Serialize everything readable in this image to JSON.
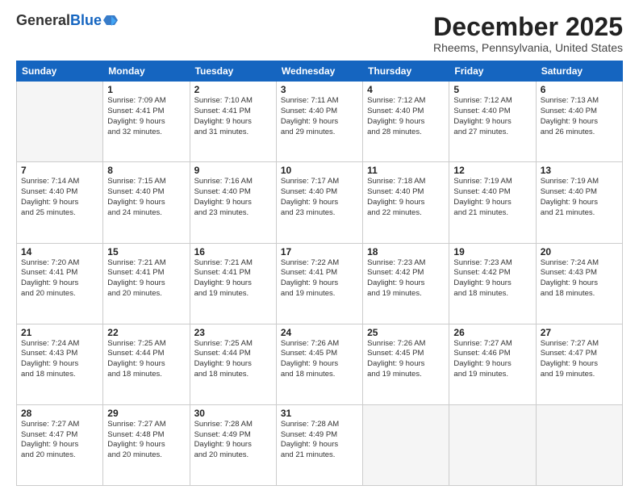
{
  "logo": {
    "general": "General",
    "blue": "Blue"
  },
  "title": "December 2025",
  "subtitle": "Rheems, Pennsylvania, United States",
  "days_of_week": [
    "Sunday",
    "Monday",
    "Tuesday",
    "Wednesday",
    "Thursday",
    "Friday",
    "Saturday"
  ],
  "weeks": [
    [
      {
        "day": "",
        "info": ""
      },
      {
        "day": "1",
        "info": "Sunrise: 7:09 AM\nSunset: 4:41 PM\nDaylight: 9 hours\nand 32 minutes."
      },
      {
        "day": "2",
        "info": "Sunrise: 7:10 AM\nSunset: 4:41 PM\nDaylight: 9 hours\nand 31 minutes."
      },
      {
        "day": "3",
        "info": "Sunrise: 7:11 AM\nSunset: 4:40 PM\nDaylight: 9 hours\nand 29 minutes."
      },
      {
        "day": "4",
        "info": "Sunrise: 7:12 AM\nSunset: 4:40 PM\nDaylight: 9 hours\nand 28 minutes."
      },
      {
        "day": "5",
        "info": "Sunrise: 7:12 AM\nSunset: 4:40 PM\nDaylight: 9 hours\nand 27 minutes."
      },
      {
        "day": "6",
        "info": "Sunrise: 7:13 AM\nSunset: 4:40 PM\nDaylight: 9 hours\nand 26 minutes."
      }
    ],
    [
      {
        "day": "7",
        "info": "Sunrise: 7:14 AM\nSunset: 4:40 PM\nDaylight: 9 hours\nand 25 minutes."
      },
      {
        "day": "8",
        "info": "Sunrise: 7:15 AM\nSunset: 4:40 PM\nDaylight: 9 hours\nand 24 minutes."
      },
      {
        "day": "9",
        "info": "Sunrise: 7:16 AM\nSunset: 4:40 PM\nDaylight: 9 hours\nand 23 minutes."
      },
      {
        "day": "10",
        "info": "Sunrise: 7:17 AM\nSunset: 4:40 PM\nDaylight: 9 hours\nand 23 minutes."
      },
      {
        "day": "11",
        "info": "Sunrise: 7:18 AM\nSunset: 4:40 PM\nDaylight: 9 hours\nand 22 minutes."
      },
      {
        "day": "12",
        "info": "Sunrise: 7:19 AM\nSunset: 4:40 PM\nDaylight: 9 hours\nand 21 minutes."
      },
      {
        "day": "13",
        "info": "Sunrise: 7:19 AM\nSunset: 4:40 PM\nDaylight: 9 hours\nand 21 minutes."
      }
    ],
    [
      {
        "day": "14",
        "info": "Sunrise: 7:20 AM\nSunset: 4:41 PM\nDaylight: 9 hours\nand 20 minutes."
      },
      {
        "day": "15",
        "info": "Sunrise: 7:21 AM\nSunset: 4:41 PM\nDaylight: 9 hours\nand 20 minutes."
      },
      {
        "day": "16",
        "info": "Sunrise: 7:21 AM\nSunset: 4:41 PM\nDaylight: 9 hours\nand 19 minutes."
      },
      {
        "day": "17",
        "info": "Sunrise: 7:22 AM\nSunset: 4:41 PM\nDaylight: 9 hours\nand 19 minutes."
      },
      {
        "day": "18",
        "info": "Sunrise: 7:23 AM\nSunset: 4:42 PM\nDaylight: 9 hours\nand 19 minutes."
      },
      {
        "day": "19",
        "info": "Sunrise: 7:23 AM\nSunset: 4:42 PM\nDaylight: 9 hours\nand 18 minutes."
      },
      {
        "day": "20",
        "info": "Sunrise: 7:24 AM\nSunset: 4:43 PM\nDaylight: 9 hours\nand 18 minutes."
      }
    ],
    [
      {
        "day": "21",
        "info": "Sunrise: 7:24 AM\nSunset: 4:43 PM\nDaylight: 9 hours\nand 18 minutes."
      },
      {
        "day": "22",
        "info": "Sunrise: 7:25 AM\nSunset: 4:44 PM\nDaylight: 9 hours\nand 18 minutes."
      },
      {
        "day": "23",
        "info": "Sunrise: 7:25 AM\nSunset: 4:44 PM\nDaylight: 9 hours\nand 18 minutes."
      },
      {
        "day": "24",
        "info": "Sunrise: 7:26 AM\nSunset: 4:45 PM\nDaylight: 9 hours\nand 18 minutes."
      },
      {
        "day": "25",
        "info": "Sunrise: 7:26 AM\nSunset: 4:45 PM\nDaylight: 9 hours\nand 19 minutes."
      },
      {
        "day": "26",
        "info": "Sunrise: 7:27 AM\nSunset: 4:46 PM\nDaylight: 9 hours\nand 19 minutes."
      },
      {
        "day": "27",
        "info": "Sunrise: 7:27 AM\nSunset: 4:47 PM\nDaylight: 9 hours\nand 19 minutes."
      }
    ],
    [
      {
        "day": "28",
        "info": "Sunrise: 7:27 AM\nSunset: 4:47 PM\nDaylight: 9 hours\nand 20 minutes."
      },
      {
        "day": "29",
        "info": "Sunrise: 7:27 AM\nSunset: 4:48 PM\nDaylight: 9 hours\nand 20 minutes."
      },
      {
        "day": "30",
        "info": "Sunrise: 7:28 AM\nSunset: 4:49 PM\nDaylight: 9 hours\nand 20 minutes."
      },
      {
        "day": "31",
        "info": "Sunrise: 7:28 AM\nSunset: 4:49 PM\nDaylight: 9 hours\nand 21 minutes."
      },
      {
        "day": "",
        "info": ""
      },
      {
        "day": "",
        "info": ""
      },
      {
        "day": "",
        "info": ""
      }
    ]
  ]
}
